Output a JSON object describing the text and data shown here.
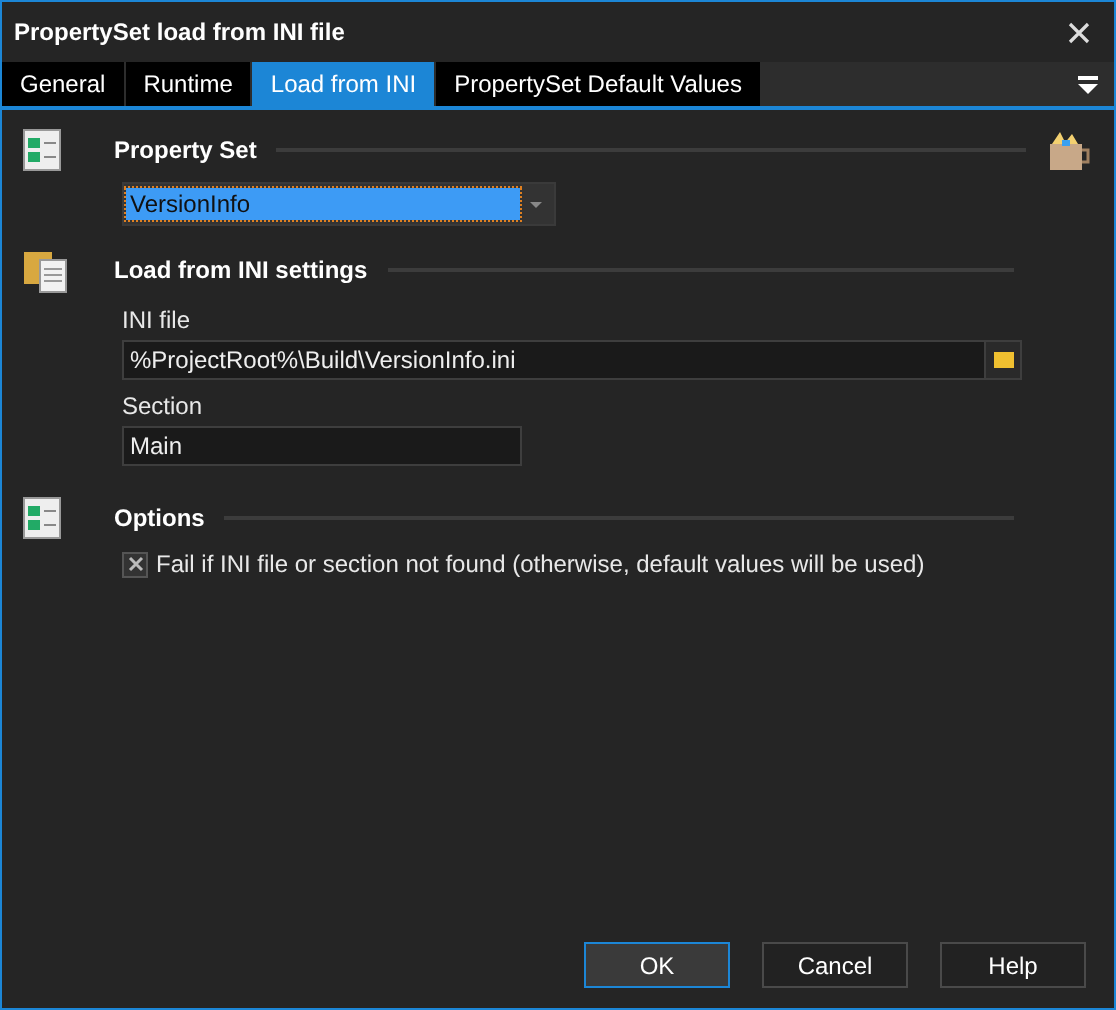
{
  "window": {
    "title": "PropertySet load from INI file"
  },
  "tabs": [
    {
      "label": "General",
      "selected": false
    },
    {
      "label": "Runtime",
      "selected": false
    },
    {
      "label": "Load from INI",
      "selected": true
    },
    {
      "label": "PropertySet Default Values",
      "selected": false
    }
  ],
  "property_set": {
    "heading": "Property Set",
    "value": "VersionInfo"
  },
  "load_settings": {
    "heading": "Load from INI settings",
    "ini_file_label": "INI file",
    "ini_file": "%ProjectRoot%\\Build\\VersionInfo.ini",
    "section_label": "Section",
    "section": "Main"
  },
  "options": {
    "heading": "Options",
    "items": [
      {
        "label": "Fail if INI file or section not found (otherwise, default values will be used)",
        "checked": true
      }
    ]
  },
  "buttons": [
    {
      "label": "OK",
      "selected": true
    },
    {
      "label": "Cancel",
      "selected": false
    },
    {
      "label": "Help",
      "selected": false
    }
  ]
}
